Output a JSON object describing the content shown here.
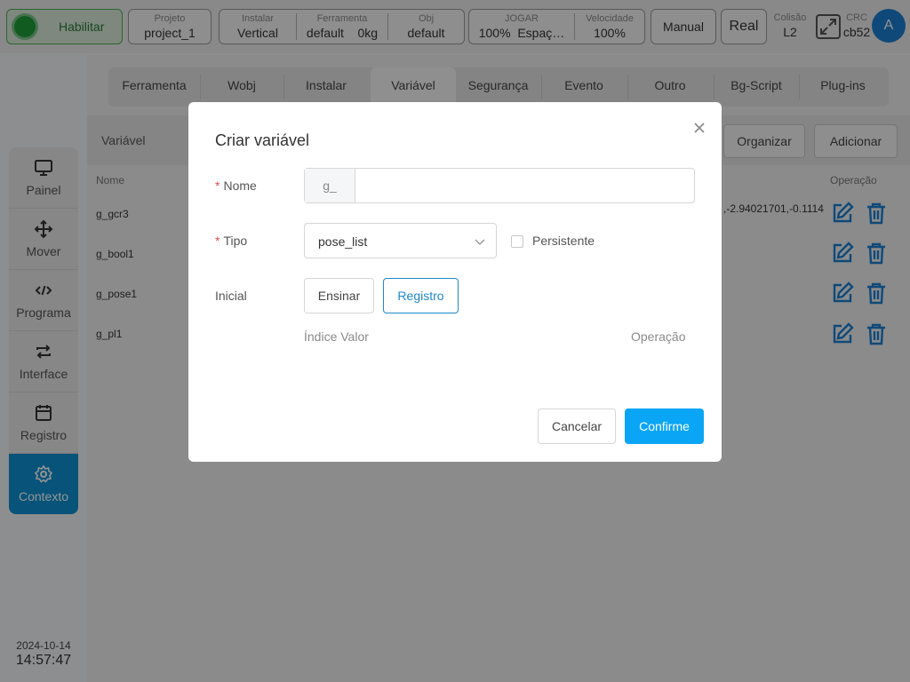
{
  "topbar": {
    "enable_label": "Habilitar",
    "project_key": "Projeto",
    "project_value": "project_1",
    "install_key": "Instalar",
    "install_value": "Vertical",
    "tool_key": "Ferramenta",
    "tool_value": "default",
    "tool_load": "0kg",
    "obj_key": "Obj",
    "obj_value": "default",
    "jog_key": "JOGAR",
    "jog_value": "100%",
    "jog_space": "Espaç…",
    "speed_key": "Velocidade",
    "speed_value": "100%",
    "mode_button": "Manual",
    "real_button": "Real",
    "collision_key": "Colisão",
    "collision_value": "L2",
    "crc_key": "CRC",
    "crc_value": "cb52",
    "avatar_letter": "A"
  },
  "sidebar": {
    "items": [
      {
        "label": "Painel",
        "icon": "monitor-icon"
      },
      {
        "label": "Mover",
        "icon": "move-icon"
      },
      {
        "label": "Programa",
        "icon": "code-icon"
      },
      {
        "label": "Interface",
        "icon": "swap-icon"
      },
      {
        "label": "Registro",
        "icon": "calendar-icon"
      },
      {
        "label": "Contexto",
        "icon": "gear-icon",
        "active": true
      }
    ],
    "date": "2024-10-14",
    "time": "14:57:47"
  },
  "tabs": [
    "Ferramenta",
    "Wobj",
    "Instalar",
    "Variável",
    "Segurança",
    "Evento",
    "Outro",
    "Bg-Script",
    "Plug-ins"
  ],
  "variable_panel": {
    "title": "Variável",
    "organize_button": "Organizar",
    "add_button": "Adicionar",
    "col_name": "Nome",
    "col_operation": "Operação",
    "rows": [
      "g_gcr3",
      "g_bool1",
      "g_pose1",
      "g_pl1"
    ],
    "row1_value": ",-2.94021701,-0.1114"
  },
  "modal": {
    "title": "Criar variável",
    "name_label": "Nome",
    "name_prefix": "g_",
    "name_value": "",
    "type_label": "Tipo",
    "type_value": "pose_list",
    "persistent_label": "Persistente",
    "initial_label": "Inicial",
    "teach_button": "Ensinar",
    "record_button": "Registro",
    "grid_index_value": "Índice Valor",
    "grid_operation": "Operação",
    "cancel_button": "Cancelar",
    "confirm_button": "Confirme"
  },
  "colors": {
    "accent": "#0aa6f5",
    "active_sidebar": "#0e8fd0",
    "enable_green": "#1e9e3a",
    "icon_blue": "#1a7fd0"
  }
}
